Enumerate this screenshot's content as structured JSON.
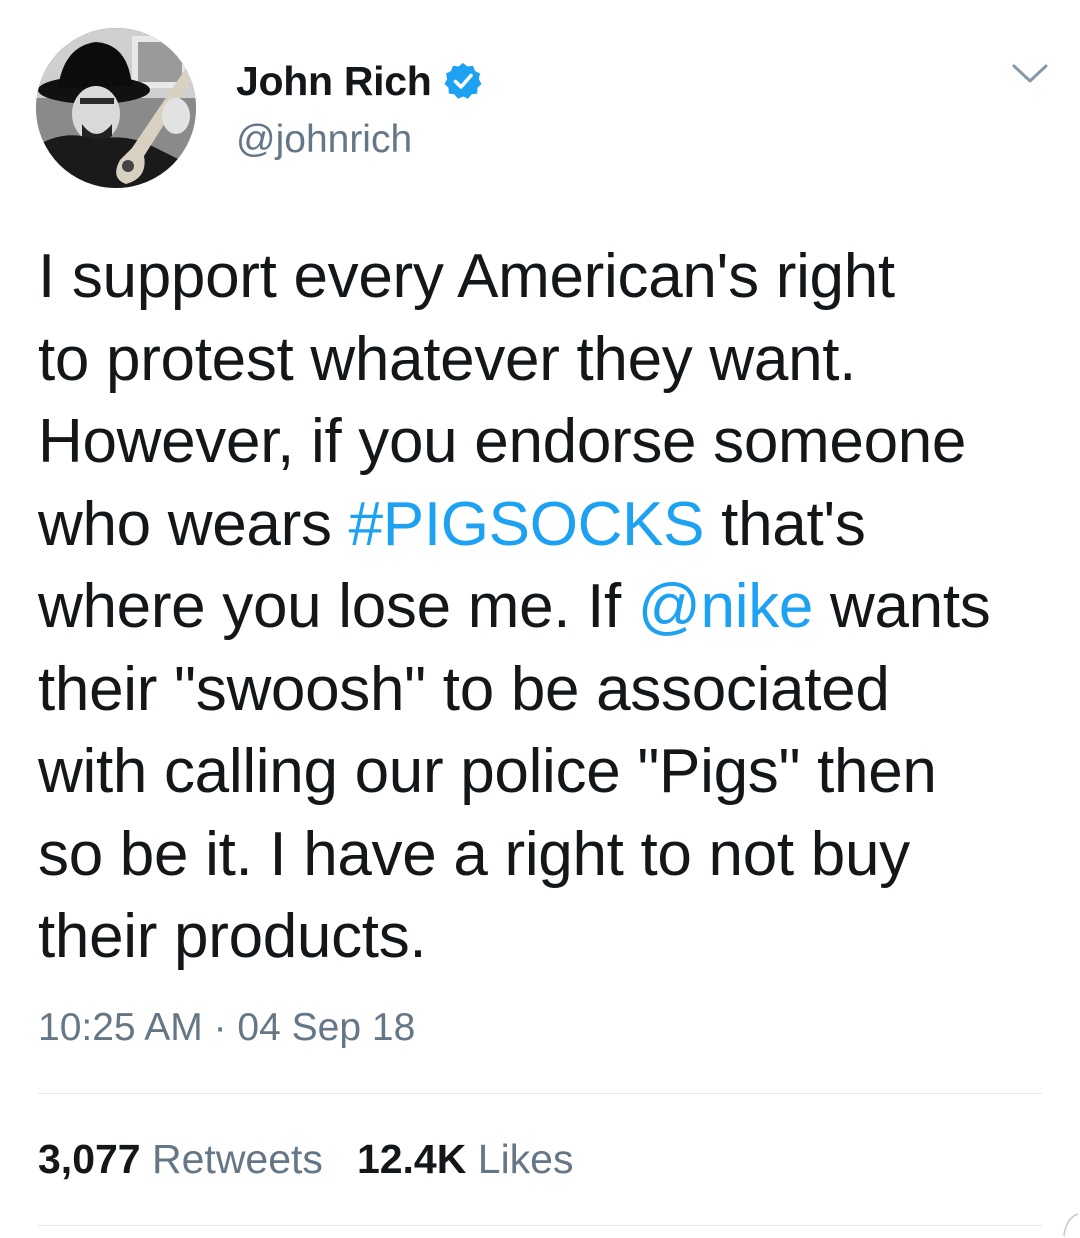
{
  "tweet": {
    "author": {
      "display_name": "John Rich",
      "handle": "@johnrich",
      "verified": true
    },
    "text_lines": [
      [
        {
          "t": "I support every American's right"
        }
      ],
      [
        {
          "t": "to protest whatever they want."
        }
      ],
      [
        {
          "t": "However, if you endorse someone"
        }
      ],
      [
        {
          "t": "who wears "
        },
        {
          "t": "#PIGSOCKS",
          "link": true
        },
        {
          "t": " that's"
        }
      ],
      [
        {
          "t": "where you lose me. If "
        },
        {
          "t": "@nike",
          "link": true
        },
        {
          "t": " wants"
        }
      ],
      [
        {
          "t": "their \"swoosh\" to be associated"
        }
      ],
      [
        {
          "t": "with calling our police \"Pigs\" then"
        }
      ],
      [
        {
          "t": "so be it. I have a right to not buy"
        }
      ],
      [
        {
          "t": "their products."
        }
      ]
    ],
    "timestamp": "10:25 AM · 04 Sep 18",
    "stats": {
      "retweets_count": "3,077",
      "retweets_label": "Retweets",
      "likes_count": "12.4K",
      "likes_label": "Likes"
    }
  },
  "colors": {
    "link": "#1da1f2",
    "text": "#14171a",
    "secondary": "#657786",
    "verified_badge": "#1da1f2"
  },
  "icons": {
    "verified": "verified-badge-icon",
    "menu": "chevron-down-icon"
  }
}
